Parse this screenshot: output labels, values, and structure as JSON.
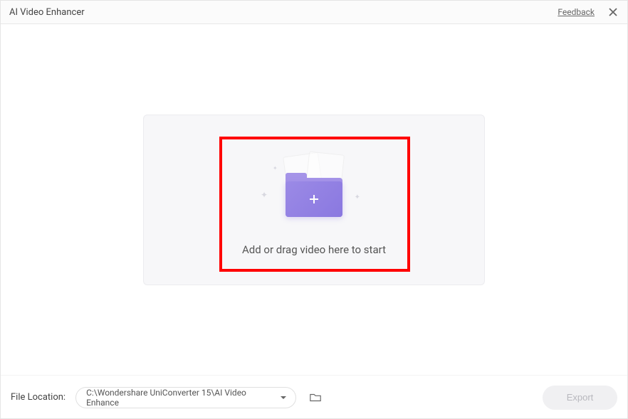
{
  "header": {
    "title": "AI Video Enhancer",
    "feedback": "Feedback"
  },
  "drop": {
    "text": "Add or drag video here to start"
  },
  "footer": {
    "label": "File Location:",
    "path": "C:\\Wondershare UniConverter 15\\AI Video Enhance",
    "export": "Export"
  }
}
